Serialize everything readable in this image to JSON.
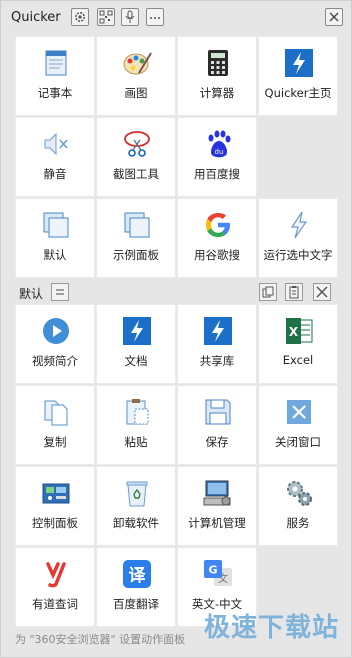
{
  "app": {
    "title": "Quicker"
  },
  "top_grid": [
    {
      "label": "记事本",
      "icon": "notepad-icon"
    },
    {
      "label": "画图",
      "icon": "paint-icon"
    },
    {
      "label": "计算器",
      "icon": "calculator-icon"
    },
    {
      "label": "Quicker主页",
      "icon": "quicker-icon"
    },
    {
      "label": "静音",
      "icon": "mute-icon"
    },
    {
      "label": "截图工具",
      "icon": "snipping-tool-icon"
    },
    {
      "label": "用百度搜",
      "icon": "baidu-icon"
    },
    {
      "label": "默认",
      "icon": "window-icon"
    },
    {
      "label": "示例面板",
      "icon": "window-icon"
    },
    {
      "label": "用谷歌搜",
      "icon": "google-icon"
    },
    {
      "label": "运行选中文字",
      "icon": "lightning-outline-icon"
    }
  ],
  "section": {
    "label": "默认"
  },
  "bottom_grid": [
    {
      "label": "视频简介",
      "icon": "play-icon"
    },
    {
      "label": "文档",
      "icon": "quicker-icon"
    },
    {
      "label": "共享库",
      "icon": "quicker-icon"
    },
    {
      "label": "Excel",
      "icon": "excel-icon"
    },
    {
      "label": "复制",
      "icon": "copy-icon"
    },
    {
      "label": "粘贴",
      "icon": "paste-icon"
    },
    {
      "label": "保存",
      "icon": "save-icon"
    },
    {
      "label": "关闭窗口",
      "icon": "close-window-icon"
    },
    {
      "label": "控制面板",
      "icon": "control-panel-icon"
    },
    {
      "label": "卸载软件",
      "icon": "recycle-bin-icon"
    },
    {
      "label": "计算机管理",
      "icon": "computer-management-icon"
    },
    {
      "label": "服务",
      "icon": "gears-icon"
    },
    {
      "label": "有道查词",
      "icon": "youdao-icon"
    },
    {
      "label": "百度翻译",
      "icon": "baidu-translate-icon"
    },
    {
      "label": "英文-中文",
      "icon": "google-translate-icon"
    }
  ],
  "footer": {
    "text": "为 \"360安全浏览器\" 设置动作面板"
  },
  "watermark": {
    "text": "极速下载站"
  },
  "colors": {
    "background": "#e6e6e6",
    "cell": "#ffffff",
    "accent": "#1b6fc8"
  }
}
